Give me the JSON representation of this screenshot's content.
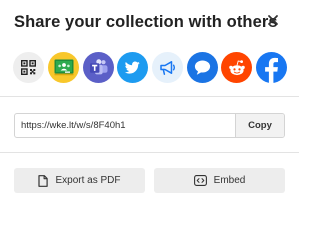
{
  "dialog": {
    "title": "Share your collection with others",
    "close_icon": "close-icon"
  },
  "share_targets": [
    {
      "name": "qr-code",
      "icon": "qr-code-icon",
      "bg": "#eeeeee"
    },
    {
      "name": "google-classroom",
      "icon": "google-classroom-icon",
      "bg": "#f8c72b"
    },
    {
      "name": "microsoft-teams",
      "icon": "microsoft-teams-icon",
      "bg": "#5b5fc7"
    },
    {
      "name": "twitter",
      "icon": "twitter-bird-icon",
      "bg": "#1d9bf0"
    },
    {
      "name": "announcement",
      "icon": "megaphone-icon",
      "bg": "#e6f1fb"
    },
    {
      "name": "messenger",
      "icon": "speech-bubble-icon",
      "bg": "#1b74e4"
    },
    {
      "name": "reddit",
      "icon": "reddit-icon",
      "bg": "#ff4500"
    },
    {
      "name": "facebook",
      "icon": "facebook-icon",
      "bg": "#1877f2"
    }
  ],
  "link": {
    "url": "https://wke.lt/w/s/8F40h1",
    "copy_label": "Copy"
  },
  "actions": {
    "export_pdf_label": "Export as PDF",
    "embed_label": "Embed"
  }
}
